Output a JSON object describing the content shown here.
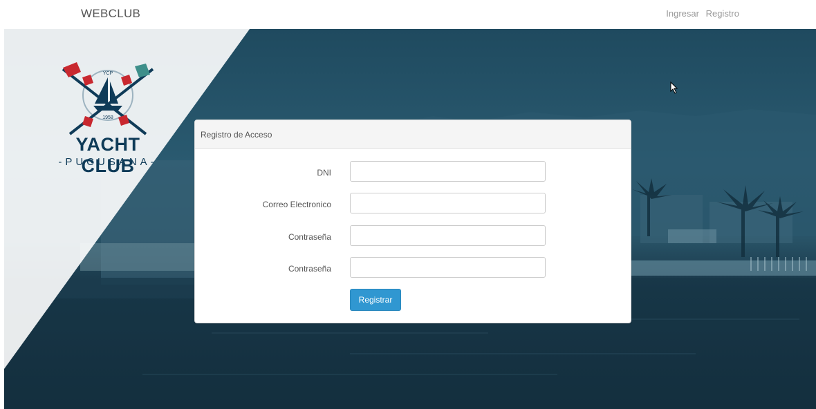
{
  "navbar": {
    "brand": "WEBCLUB",
    "links": [
      "Ingresar",
      "Registro"
    ]
  },
  "logo": {
    "initials": "YCP",
    "year": "1958",
    "title": "YACHT CLUB",
    "subtitle": "-PUCUSANA-"
  },
  "form": {
    "heading": "Registro de Acceso",
    "fields": [
      {
        "label": "DNI",
        "value": ""
      },
      {
        "label": "Correo Electronico",
        "value": ""
      },
      {
        "label": "Contraseña",
        "value": ""
      },
      {
        "label": "Contraseña",
        "value": ""
      }
    ],
    "submit_label": "Registrar"
  },
  "colors": {
    "primary_button": "#3097d1",
    "logo_navy": "#0f3b58",
    "hero_overlay": "#1f4a5f"
  }
}
